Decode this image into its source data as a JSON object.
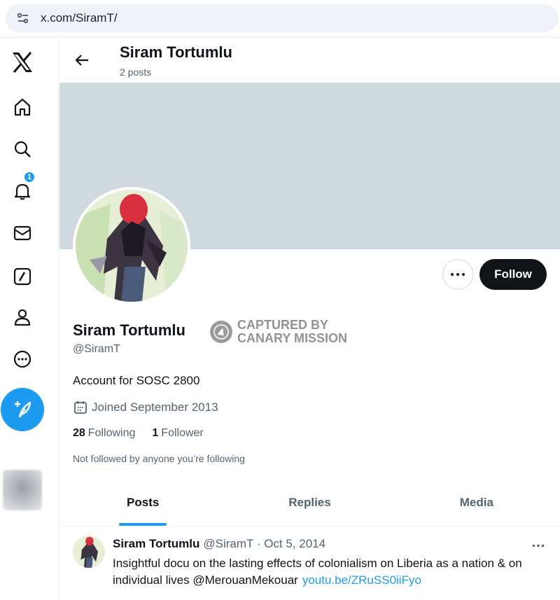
{
  "browser": {
    "url": "x.com/SiramT/"
  },
  "sidebar": {
    "notification_count": "1",
    "items": [
      {
        "name": "x-logo-icon"
      },
      {
        "name": "home-icon"
      },
      {
        "name": "search-icon"
      },
      {
        "name": "notifications-icon"
      },
      {
        "name": "messages-icon"
      },
      {
        "name": "grok-icon"
      },
      {
        "name": "profile-icon"
      },
      {
        "name": "more-icon"
      }
    ]
  },
  "header": {
    "name": "Siram Tortumlu",
    "posts_count": "2 posts"
  },
  "profile": {
    "name": "Siram Tortumlu",
    "handle": "@SiramT",
    "bio": "Account for SOSC 2800",
    "joined": "Joined September 2013",
    "following_count": "28",
    "following_label": "Following",
    "followers_count": "1",
    "followers_label": "Follower",
    "not_followed": "Not followed by anyone you’re following",
    "follow_label": "Follow"
  },
  "watermark": {
    "line1": "CAPTURED BY",
    "line2": "CANARY MISSION"
  },
  "tabs": [
    {
      "label": "Posts",
      "active": true
    },
    {
      "label": "Replies",
      "active": false
    },
    {
      "label": "Media",
      "active": false
    }
  ],
  "post": {
    "name": "Siram Tortumlu",
    "meta": "@SiramT · Oct 5, 2014",
    "text": "Insightful docu on the lasting effects of colonialism on Liberia as a nation & on individual lives @MerouanMekouar",
    "link": "youtu.be/ZRuSS0iiFyo"
  },
  "colors": {
    "accent": "#1d9bf0",
    "banner": "#cfd9de",
    "text": "#0f1419",
    "muted": "#536471"
  }
}
